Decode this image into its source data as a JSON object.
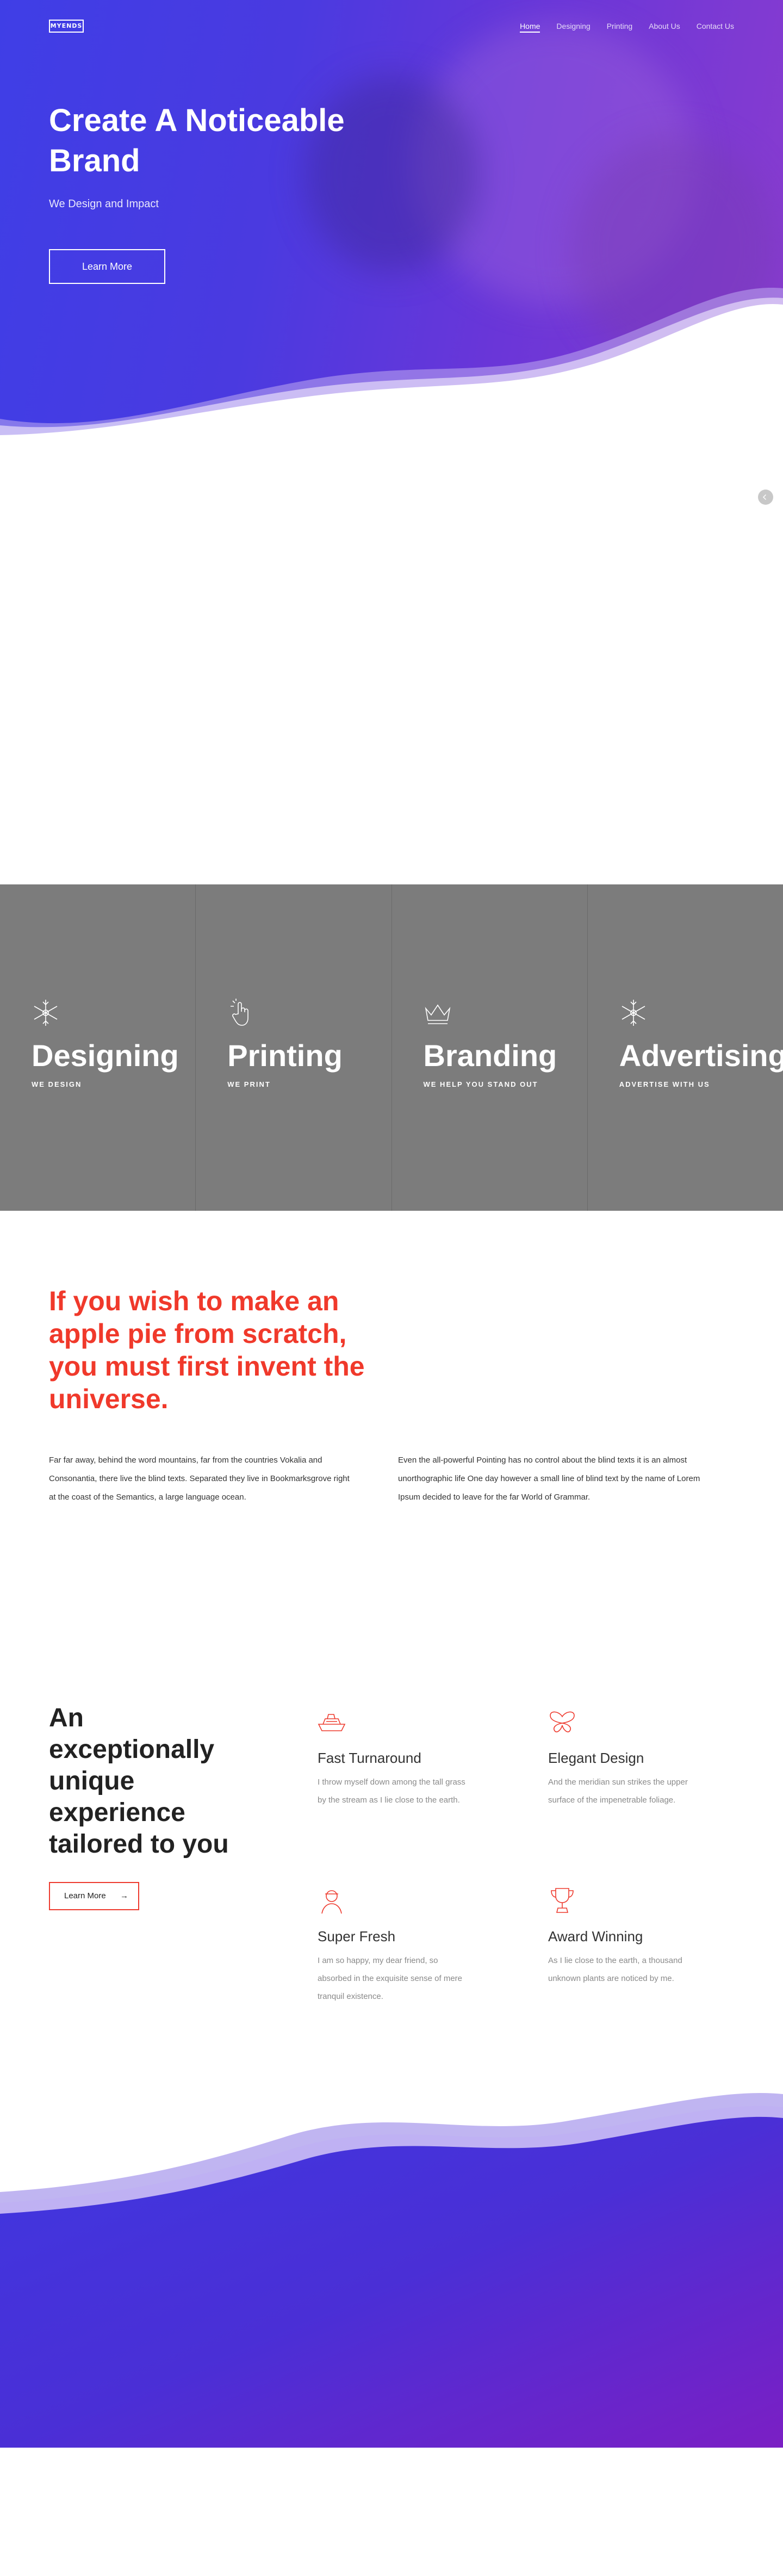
{
  "nav": {
    "logo": "MYENDS",
    "links": [
      "Home",
      "Designing",
      "Printing",
      "About Us",
      "Contact Us"
    ]
  },
  "hero": {
    "title": "Create A Noticeable Brand",
    "subtitle": "We Design and Impact",
    "button": "Learn More"
  },
  "services": [
    {
      "title": "Designing",
      "subtitle": "WE DESIGN",
      "icon": "snowflake-icon"
    },
    {
      "title": "Printing",
      "subtitle": "WE PRINT",
      "icon": "pointer-hand-icon"
    },
    {
      "title": "Branding",
      "subtitle": "WE HELP YOU STAND OUT",
      "icon": "crown-icon"
    },
    {
      "title": "Advertising",
      "subtitle": "ADVERTISE WITH US",
      "icon": "snowflake-icon"
    }
  ],
  "quote": "If you wish to make an apple pie from scratch, you must first invent the universe.",
  "paragraphs": [
    "Far far away, behind the word mountains, far from the countries Vokalia and Consonantia, there live the blind texts. Separated they live in Bookmarksgrove right at the coast of the Semantics, a large language ocean.",
    "Even the all-powerful Pointing has no control about the blind texts it is an almost unorthographic life One day however a small line of blind text by the name of Lorem Ipsum decided to leave for the far World of Grammar."
  ],
  "features": {
    "heading": "An exceptionally unique experience tailored to you",
    "button": "Learn More",
    "items": [
      {
        "title": "Fast Turnaround",
        "text": "I throw myself down among the tall grass by the stream as I lie close to the earth.",
        "icon": "ship-icon"
      },
      {
        "title": "Elegant Design",
        "text": "And the meridian sun strikes the upper surface of the impenetrable foliage.",
        "icon": "butterfly-icon"
      },
      {
        "title": "Super Fresh",
        "text": "I am so happy, my dear friend, so absorbed in the exquisite sense of mere tranquil existence.",
        "icon": "person-icon"
      },
      {
        "title": "Award Winning",
        "text": "As I lie close to the earth, a thousand unknown plants are noticed by me.",
        "icon": "trophy-icon"
      }
    ]
  },
  "colors": {
    "primary": "#4b3ae2",
    "secondary": "#8a3ccf",
    "accent": "#f0392b",
    "service_bg": "#7c7c7c"
  }
}
